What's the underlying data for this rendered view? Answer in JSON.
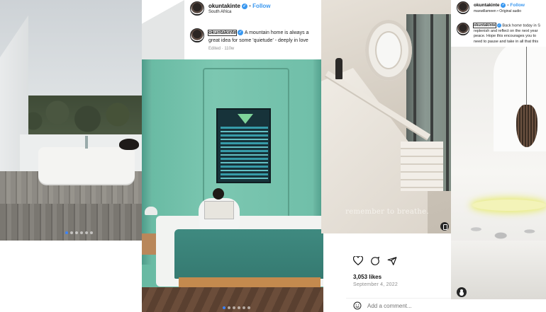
{
  "panel_bath": {
    "carousel_dots": 6,
    "carousel_active_index": 0
  },
  "panel_room": {
    "username": "okuntakinte",
    "follow": "Follow",
    "location": "South Africa",
    "caption_user": "okuntakinte",
    "caption_line1": "A mountain home is always a",
    "caption_line2": "great idea for some 'quietude' - deeply in love",
    "meta": "Edited · 110w",
    "carousel_dots": 6,
    "carousel_active_index": 0
  },
  "panel_stairs": {
    "overlay_caption": "remember to breathe.",
    "likes": "3,053 likes",
    "date": "September 4, 2022",
    "comment_placeholder": "Add a comment..."
  },
  "panel_dining": {
    "username": "okuntakinte",
    "follow": "Follow",
    "audio": "maxwillameen • Original audio",
    "caption_user": "okuntakinte",
    "caption_line1": "Back home today in S",
    "caption_line2": "replenish and reflect on the next year",
    "caption_line3": "peace. Hope this encourages you to",
    "caption_line4": "need to pause and take in all that this"
  },
  "colors": {
    "link_blue": "#3897f0",
    "active_dot": "#3b82f6"
  }
}
